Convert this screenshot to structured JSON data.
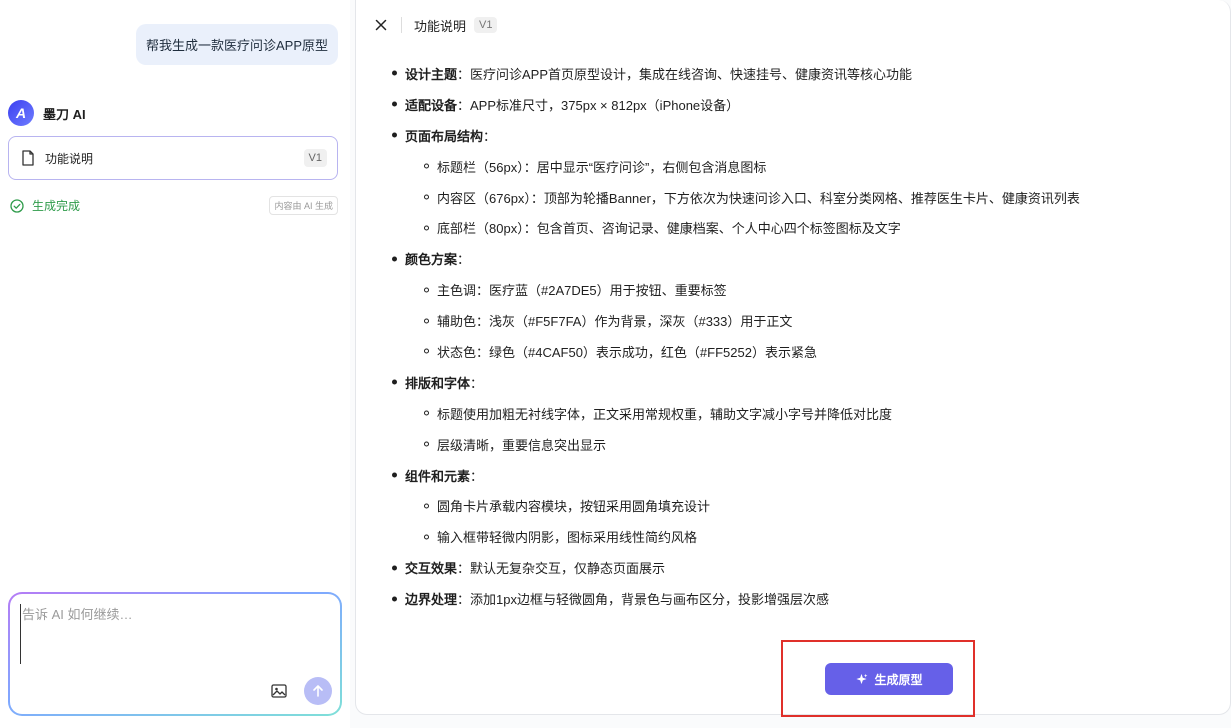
{
  "left": {
    "user_message": "帮我生成一款医疗问诊APP原型",
    "ai_name": "墨刀 AI",
    "ai_logo": "A",
    "doc_card": {
      "title": "功能说明",
      "version": "V1"
    },
    "status": {
      "text": "生成完成",
      "note": "内容由 AI 生成"
    },
    "input": {
      "placeholder": "告诉 AI 如何继续…"
    }
  },
  "right": {
    "title": "功能说明",
    "version": "V1",
    "items": [
      {
        "label": "设计主题",
        "text": "：医疗问诊APP首页原型设计，集成在线咨询、快速挂号、健康资讯等核心功能",
        "subs": []
      },
      {
        "label": "适配设备",
        "text": "：APP标准尺寸，375px × 812px（iPhone设备）",
        "subs": []
      },
      {
        "label": "页面布局结构",
        "text": "：",
        "subs": [
          "标题栏（56px）：居中显示“医疗问诊”，右侧包含消息图标",
          "内容区（676px）：顶部为轮播Banner，下方依次为快速问诊入口、科室分类网格、推荐医生卡片、健康资讯列表",
          "底部栏（80px）：包含首页、咨询记录、健康档案、个人中心四个标签图标及文字"
        ]
      },
      {
        "label": "颜色方案",
        "text": "：",
        "subs": [
          "主色调：医疗蓝（#2A7DE5）用于按钮、重要标签",
          "辅助色：浅灰（#F5F7FA）作为背景，深灰（#333）用于正文",
          "状态色：绿色（#4CAF50）表示成功，红色（#FF5252）表示紧急"
        ]
      },
      {
        "label": "排版和字体",
        "text": "：",
        "subs": [
          "标题使用加粗无衬线字体，正文采用常规权重，辅助文字减小字号并降低对比度",
          "层级清晰，重要信息突出显示"
        ]
      },
      {
        "label": "组件和元素",
        "text": "：",
        "subs": [
          "圆角卡片承载内容模块，按钮采用圆角填充设计",
          "输入框带轻微内阴影，图标采用线性简约风格"
        ]
      },
      {
        "label": "交互效果",
        "text": "：默认无复杂交互，仅静态页面展示",
        "subs": []
      },
      {
        "label": "边界处理",
        "text": "：添加1px边框与轻微圆角，背景色与画布区分，投影增强层次感",
        "subs": []
      }
    ],
    "generate_button": "生成原型"
  },
  "colors": {
    "accent": "#6660e8",
    "success": "#2e9b4a",
    "highlight_frame": "#e0302a"
  },
  "icons": [
    "file-icon",
    "check-circle-icon",
    "image-icon",
    "send-arrow-icon",
    "close-icon",
    "sparkle-icon"
  ]
}
